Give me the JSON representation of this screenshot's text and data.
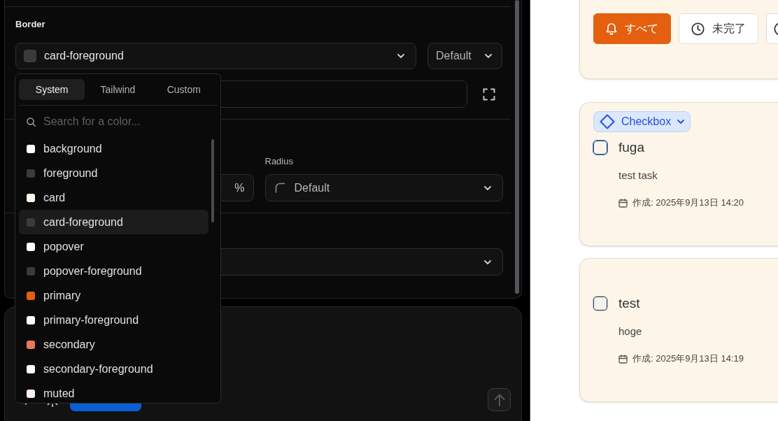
{
  "settings": {
    "border": {
      "label": "Border",
      "color_select": {
        "value": "card-foreground"
      },
      "style_select": {
        "value": "Default"
      }
    },
    "size": {
      "percent_field": {
        "unit": "%"
      },
      "radius_select": {
        "label": "Radius",
        "value": "Default"
      }
    }
  },
  "color_picker": {
    "tabs": [
      {
        "label": "System",
        "selected": true
      },
      {
        "label": "Tailwind",
        "selected": false
      },
      {
        "label": "Custom",
        "selected": false
      }
    ],
    "search": {
      "placeholder": "Search for a color..."
    },
    "colors": [
      {
        "name": "background",
        "color": "#ffffff",
        "selected": false
      },
      {
        "name": "foreground",
        "color": "#3b3b3b",
        "selected": false
      },
      {
        "name": "card",
        "color": "#fdf6e8",
        "selected": false
      },
      {
        "name": "card-foreground",
        "color": "#3b3b3b",
        "selected": true
      },
      {
        "name": "popover",
        "color": "#ffffff",
        "selected": false
      },
      {
        "name": "popover-foreground",
        "color": "#3b3b3b",
        "selected": false
      },
      {
        "name": "primary",
        "color": "#e4600f",
        "selected": false
      },
      {
        "name": "primary-foreground",
        "color": "#ffffff",
        "selected": false
      },
      {
        "name": "secondary",
        "color": "#e8785c",
        "selected": false
      },
      {
        "name": "secondary-foreground",
        "color": "#ffffff",
        "selected": false
      },
      {
        "name": "muted",
        "color": "#fdf0ec",
        "selected": false
      }
    ]
  },
  "filters": [
    {
      "label": "すべて",
      "selected": true
    },
    {
      "label": "未完了",
      "selected": false
    },
    {
      "selected": false
    }
  ],
  "tasks": [
    {
      "badge": "Checkbox",
      "title": "fuga",
      "description": "test task",
      "created": "作成: 2025年9月13日 14:20",
      "checked": false,
      "selected": true
    },
    {
      "title": "test",
      "description": "hoge",
      "created": "作成: 2025年9月13日 14:19",
      "checked": false,
      "selected": false
    }
  ]
}
